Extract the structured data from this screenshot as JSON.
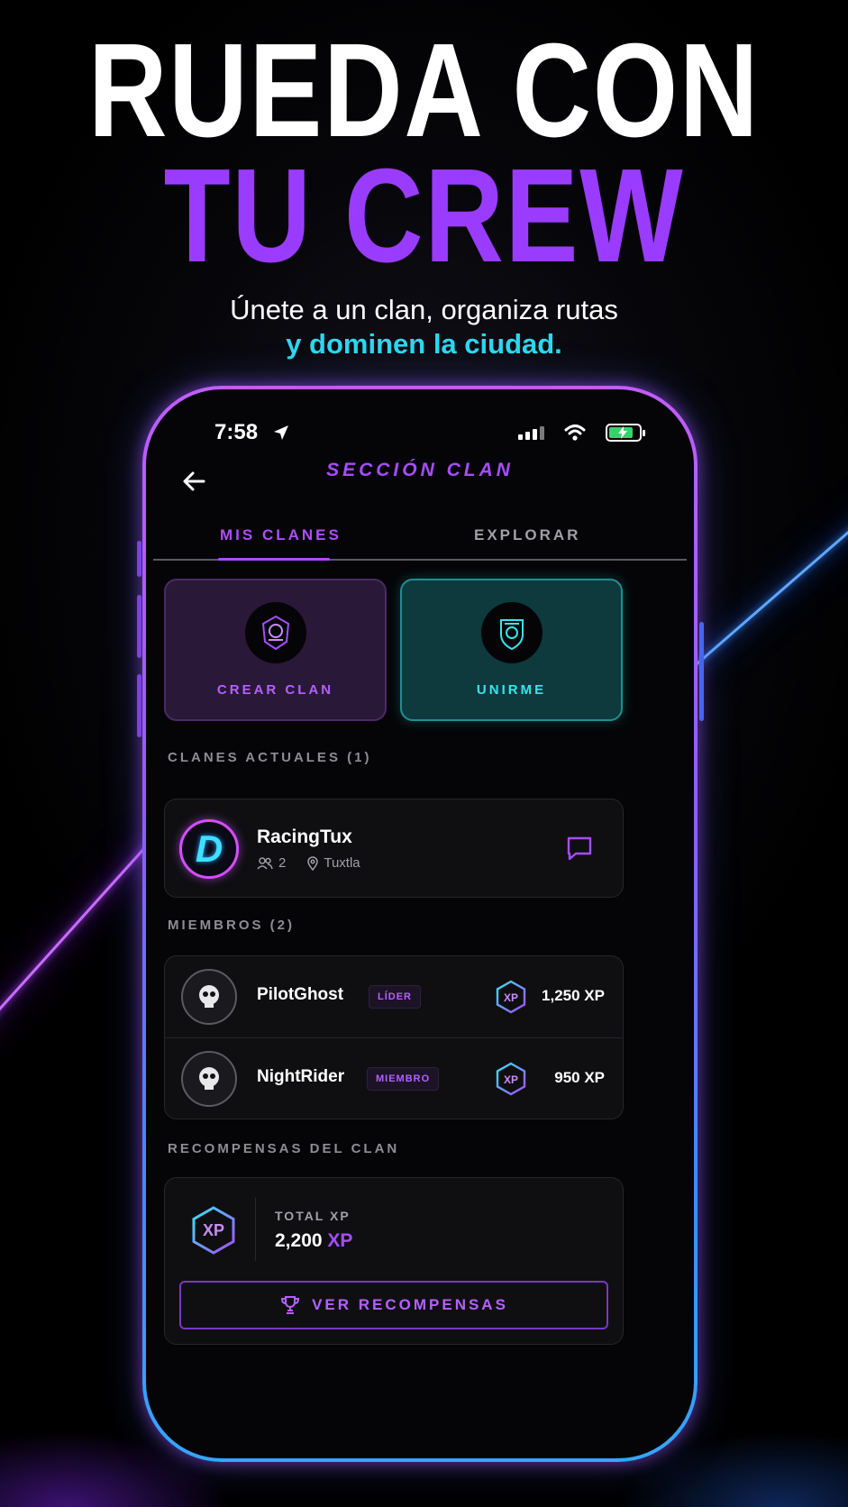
{
  "headline": {
    "line1": "RUEDA CON",
    "line2": "TU CREW",
    "subtitle1": "Únete a un clan, organiza rutas",
    "subtitle2": "y dominen la ciudad."
  },
  "status_bar": {
    "time": "7:58"
  },
  "header": {
    "title": "SECCIÓN CLAN"
  },
  "tabs": [
    {
      "label": "MIS CLANES",
      "active": true
    },
    {
      "label": "EXPLORAR",
      "active": false
    }
  ],
  "actions": {
    "create_label": "CREAR CLAN",
    "join_label": "UNIRME"
  },
  "current_clans": {
    "heading": "CLANES ACTUALES (1)",
    "clan": {
      "logo_letter": "D",
      "name": "RacingTux",
      "members": "2",
      "location": "Tuxtla"
    }
  },
  "members": {
    "heading": "MIEMBROS (2)",
    "list": [
      {
        "name": "PilotGhost",
        "role": "LÍDER",
        "xp": "1,250 XP"
      },
      {
        "name": "NightRider",
        "role": "MIEMBRO",
        "xp": "950 XP"
      }
    ],
    "xp_icon_label": "XP"
  },
  "rewards": {
    "heading": "RECOMPENSAS DEL CLAN",
    "icon_label": "XP",
    "total_label": "TOTAL XP",
    "total_value": "2,200",
    "total_unit": "XP",
    "button_label": "VER RECOMPENSAS"
  },
  "colors": {
    "accent_purple": "#a64dff",
    "accent_cyan": "#2bd8ef",
    "background": "#050507"
  }
}
